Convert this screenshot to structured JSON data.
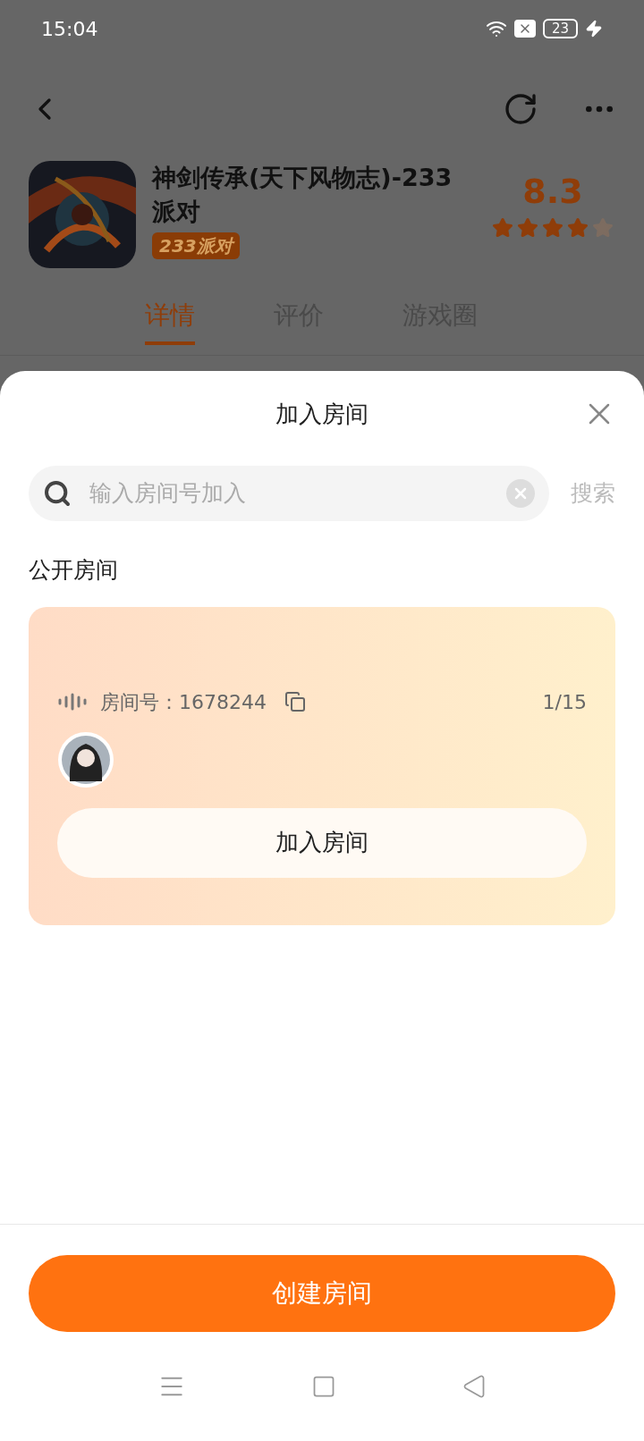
{
  "status_bar": {
    "time": "15:04",
    "battery": "23"
  },
  "app": {
    "title": "神剑传承(天下风物志)-233派对",
    "badge": "233派对",
    "score": "8.3",
    "stars": 4
  },
  "tabs": [
    {
      "label": "详情",
      "selected": true
    },
    {
      "label": "评价",
      "selected": false
    },
    {
      "label": "游戏圈",
      "selected": false
    }
  ],
  "sheet": {
    "title": "加入房间",
    "search": {
      "placeholder": "输入房间号加入",
      "button": "搜索"
    },
    "section": "公开房间",
    "rooms": [
      {
        "label": "房间号：",
        "number": "1678244",
        "count": "1/15",
        "join": "加入房间"
      }
    ],
    "create": "创建房间"
  }
}
